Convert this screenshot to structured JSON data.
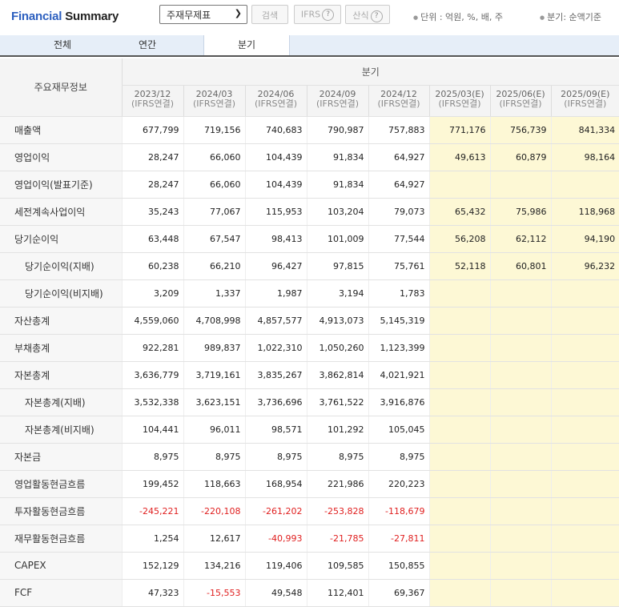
{
  "header": {
    "title_part1": "Financial",
    "title_part2": "Summary",
    "select_value": "주재무제표",
    "search_label": "검색",
    "ifrs_label": "IFRS",
    "formula_label": "산식",
    "help_glyph": "?",
    "unit_text": "단위 : 억원, %, 배, 주",
    "quarter_text": "분기: 순액기준"
  },
  "tabs": [
    "전체",
    "연간",
    "분기"
  ],
  "table": {
    "row_header": "주요재무정보",
    "group_header": "분기",
    "columns": [
      {
        "period": "2023/12",
        "basis": "(IFRS연결)"
      },
      {
        "period": "2024/03",
        "basis": "(IFRS연결)"
      },
      {
        "period": "2024/06",
        "basis": "(IFRS연결)"
      },
      {
        "period": "2024/09",
        "basis": "(IFRS연결)"
      },
      {
        "period": "2024/12",
        "basis": "(IFRS연결)"
      },
      {
        "period": "2025/03(E)",
        "basis": "(IFRS연결)"
      },
      {
        "period": "2025/06(E)",
        "basis": "(IFRS연결)"
      },
      {
        "period": "2025/09(E)",
        "basis": "(IFRS연결)"
      }
    ],
    "rows": [
      {
        "label": "매출액",
        "indent": false,
        "values": [
          "677,799",
          "719,156",
          "740,683",
          "790,987",
          "757,883",
          "771,176",
          "756,739",
          "841,334"
        ]
      },
      {
        "label": "영업이익",
        "indent": false,
        "values": [
          "28,247",
          "66,060",
          "104,439",
          "91,834",
          "64,927",
          "49,613",
          "60,879",
          "98,164"
        ]
      },
      {
        "label": "영업이익(발표기준)",
        "indent": false,
        "values": [
          "28,247",
          "66,060",
          "104,439",
          "91,834",
          "64,927",
          "",
          "",
          ""
        ]
      },
      {
        "label": "세전계속사업이익",
        "indent": false,
        "values": [
          "35,243",
          "77,067",
          "115,953",
          "103,204",
          "79,073",
          "65,432",
          "75,986",
          "118,968"
        ]
      },
      {
        "label": "당기순이익",
        "indent": false,
        "values": [
          "63,448",
          "67,547",
          "98,413",
          "101,009",
          "77,544",
          "56,208",
          "62,112",
          "94,190"
        ]
      },
      {
        "label": "당기순이익(지배)",
        "indent": true,
        "values": [
          "60,238",
          "66,210",
          "96,427",
          "97,815",
          "75,761",
          "52,118",
          "60,801",
          "96,232"
        ]
      },
      {
        "label": "당기순이익(비지배)",
        "indent": true,
        "values": [
          "3,209",
          "1,337",
          "1,987",
          "3,194",
          "1,783",
          "",
          "",
          ""
        ]
      },
      {
        "label": "자산총계",
        "indent": false,
        "values": [
          "4,559,060",
          "4,708,998",
          "4,857,577",
          "4,913,073",
          "5,145,319",
          "",
          "",
          ""
        ]
      },
      {
        "label": "부채총계",
        "indent": false,
        "values": [
          "922,281",
          "989,837",
          "1,022,310",
          "1,050,260",
          "1,123,399",
          "",
          "",
          ""
        ]
      },
      {
        "label": "자본총계",
        "indent": false,
        "values": [
          "3,636,779",
          "3,719,161",
          "3,835,267",
          "3,862,814",
          "4,021,921",
          "",
          "",
          ""
        ]
      },
      {
        "label": "자본총계(지배)",
        "indent": true,
        "values": [
          "3,532,338",
          "3,623,151",
          "3,736,696",
          "3,761,522",
          "3,916,876",
          "",
          "",
          ""
        ]
      },
      {
        "label": "자본총계(비지배)",
        "indent": true,
        "values": [
          "104,441",
          "96,011",
          "98,571",
          "101,292",
          "105,045",
          "",
          "",
          ""
        ]
      },
      {
        "label": "자본금",
        "indent": false,
        "values": [
          "8,975",
          "8,975",
          "8,975",
          "8,975",
          "8,975",
          "",
          "",
          ""
        ]
      },
      {
        "label": "영업활동현금흐름",
        "indent": false,
        "values": [
          "199,452",
          "118,663",
          "168,954",
          "221,986",
          "220,223",
          "",
          "",
          ""
        ]
      },
      {
        "label": "투자활동현금흐름",
        "indent": false,
        "values": [
          "-245,221",
          "-220,108",
          "-261,202",
          "-253,828",
          "-118,679",
          "",
          "",
          ""
        ]
      },
      {
        "label": "재무활동현금흐름",
        "indent": false,
        "values": [
          "1,254",
          "12,617",
          "-40,993",
          "-21,785",
          "-27,811",
          "",
          "",
          ""
        ]
      },
      {
        "label": "CAPEX",
        "indent": false,
        "values": [
          "152,129",
          "134,216",
          "119,406",
          "109,585",
          "150,855",
          "",
          "",
          ""
        ]
      },
      {
        "label": "FCF",
        "indent": false,
        "values": [
          "47,323",
          "-15,553",
          "49,548",
          "112,401",
          "69,367",
          "",
          "",
          ""
        ]
      }
    ]
  }
}
